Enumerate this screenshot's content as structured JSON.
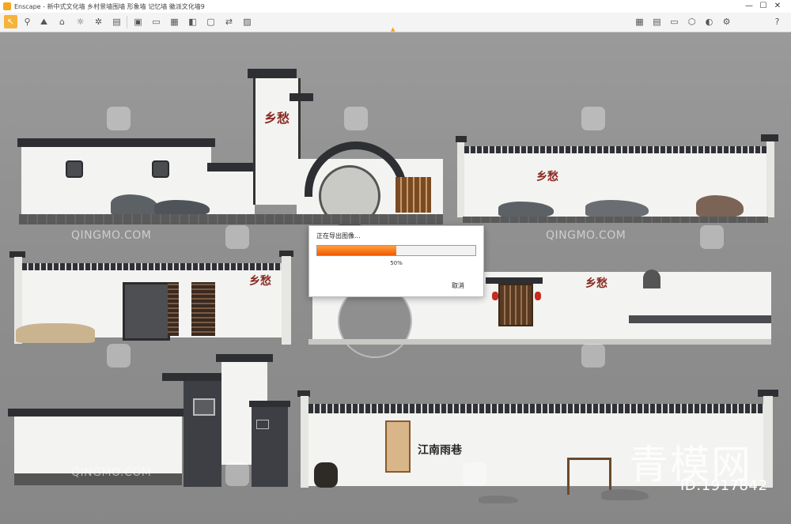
{
  "window": {
    "title": "Enscape - 新中式文化墙 乡村景墙围墙 形象墙 记忆墙 徽派文化墙9",
    "minimize": "—",
    "maximize": "☐",
    "close": "✕"
  },
  "toolbar": {
    "tools": [
      "cursor",
      "pin",
      "scene",
      "tag",
      "lightbulb",
      "fan",
      "book",
      "video",
      "monitor",
      "grid",
      "layers",
      "box",
      "box2",
      "swap",
      "image"
    ],
    "right_tools": [
      "gallery",
      "report",
      "display",
      "cube",
      "panorama",
      "settings",
      "help"
    ]
  },
  "colors": {
    "accent": "#f5a623",
    "progress": "#f05a00",
    "background": "#8e8e8e"
  },
  "viewport": {
    "watermark": "QINGMO.COM",
    "watermark_cn": "青模网",
    "id_label": "ID:1917842",
    "sign_text": "江南雨巷"
  },
  "dialog": {
    "title": "正在导出图像...",
    "progress_percent": 50,
    "progress_text": "50%",
    "cancel_label": "取消"
  }
}
